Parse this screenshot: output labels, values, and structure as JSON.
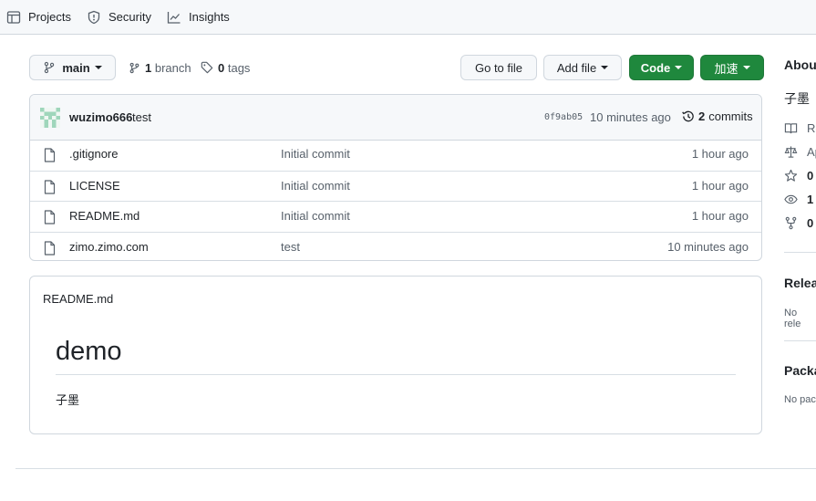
{
  "nav": {
    "projects": "Projects",
    "security": "Security",
    "insights": "Insights"
  },
  "toolbar": {
    "branch_button": "main",
    "branch_count": "1",
    "branch_label": "branch",
    "tag_count": "0",
    "tag_label": "tags",
    "go_to_file": "Go to file",
    "add_file": "Add file",
    "code": "Code",
    "accelerate": "加速"
  },
  "commit": {
    "author": "wuzimo666",
    "message": "test",
    "hash": "0f9ab05",
    "time": "10 minutes ago",
    "count": "2",
    "count_label": "commits"
  },
  "files": [
    {
      "name": ".gitignore",
      "message": "Initial commit",
      "age": "1 hour ago"
    },
    {
      "name": "LICENSE",
      "message": "Initial commit",
      "age": "1 hour ago"
    },
    {
      "name": "README.md",
      "message": "Initial commit",
      "age": "1 hour ago"
    },
    {
      "name": "zimo.zimo.com",
      "message": "test",
      "age": "10 minutes ago"
    }
  ],
  "readme": {
    "filename": "README.md",
    "heading": "demo",
    "body": "子墨"
  },
  "sidebar": {
    "about_title": "Abou",
    "description": "子墨",
    "readme": "Re",
    "license": "Ap",
    "stars": "0",
    "watchers": "1",
    "forks": "0",
    "releases_title": "Relea",
    "releases_text": "No rele",
    "packages_title": "Packa",
    "packages_text": "No pac"
  },
  "colors": {
    "accent_green": "#1f883d",
    "border": "#d0d7de",
    "muted_text": "#57606a",
    "header_bg": "#f6f8fa"
  }
}
